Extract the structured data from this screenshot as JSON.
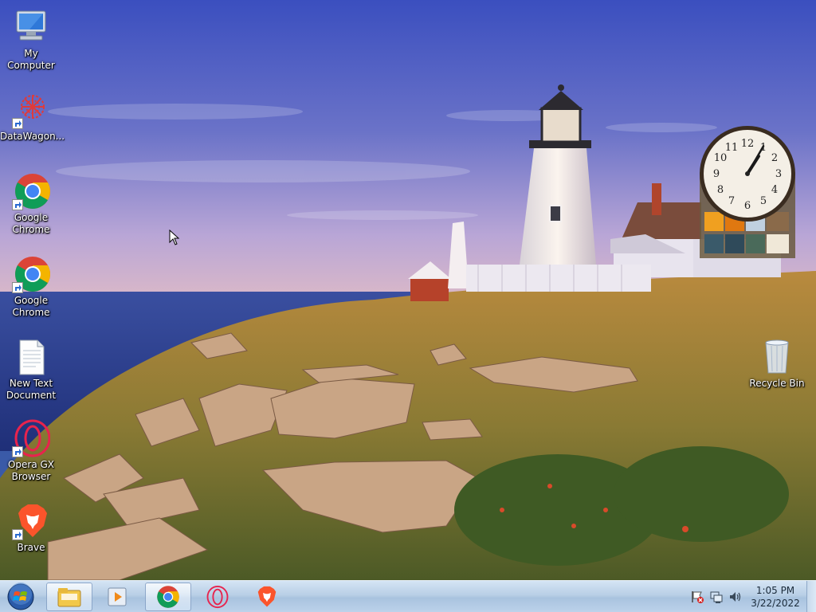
{
  "desktop": {
    "icons": [
      {
        "label": "My Computer"
      },
      {
        "label": "DataWagon..."
      },
      {
        "label": "Google\nChrome"
      },
      {
        "label": "Google\nChrome"
      },
      {
        "label": "New Text\nDocument"
      },
      {
        "label": "Opera GX\nBrowser"
      },
      {
        "label": "Brave"
      },
      {
        "label": "Recycle Bin"
      }
    ]
  },
  "clock_gadget": {
    "dial_numbers": [
      "12",
      "1",
      "2",
      "3",
      "4",
      "5",
      "6",
      "7",
      "8",
      "9",
      "10",
      "11"
    ],
    "time": "1:05"
  },
  "taskbar": {
    "start_icon": "windows-start-orb",
    "pinned": [
      {
        "icon": "file-explorer-icon",
        "active": true
      },
      {
        "icon": "media-player-icon",
        "active": false
      },
      {
        "icon": "chrome-icon",
        "active": true
      },
      {
        "icon": "opera-gx-icon",
        "active": false
      },
      {
        "icon": "brave-icon",
        "active": false
      }
    ],
    "tray": {
      "icons": [
        "action-center-flag-icon",
        "network-icon",
        "volume-icon"
      ],
      "time": "1:05 PM",
      "date": "3/22/2022"
    }
  },
  "colors": {
    "sky_top": "#3b4fbf",
    "sky_bottom": "#b9a6d6",
    "sea": "#2a3f8f",
    "taskbar": "#bcd2ea"
  }
}
